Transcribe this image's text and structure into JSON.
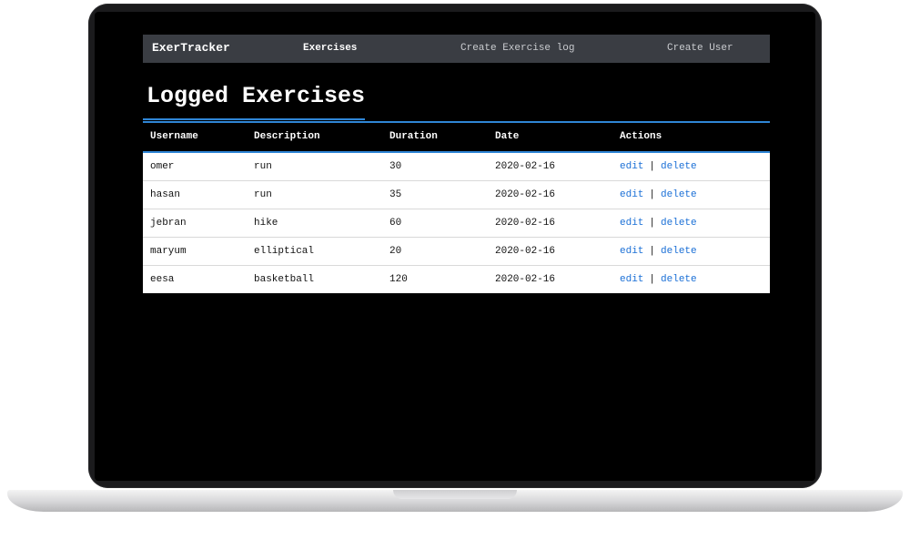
{
  "navbar": {
    "brand": "ExerTracker",
    "links": [
      "Exercises",
      "Create Exercise log",
      "Create User"
    ]
  },
  "page": {
    "title": "Logged Exercises"
  },
  "table": {
    "columns": [
      "Username",
      "Description",
      "Duration",
      "Date",
      "Actions"
    ],
    "rows": [
      {
        "username": "omer",
        "description": "run",
        "duration": "30",
        "date": "2020-02-16"
      },
      {
        "username": "hasan",
        "description": "run",
        "duration": "35",
        "date": "2020-02-16"
      },
      {
        "username": "jebran",
        "description": "hike",
        "duration": "60",
        "date": "2020-02-16"
      },
      {
        "username": "maryum",
        "description": "elliptical",
        "duration": "20",
        "date": "2020-02-16"
      },
      {
        "username": "eesa",
        "description": "basketball",
        "duration": "120",
        "date": "2020-02-16"
      }
    ],
    "actions": {
      "edit": "edit",
      "separator": "|",
      "delete": "delete"
    }
  },
  "colors": {
    "accent": "#2f86d6",
    "link": "#1a6fd6",
    "navbar": "#3a3d43"
  }
}
